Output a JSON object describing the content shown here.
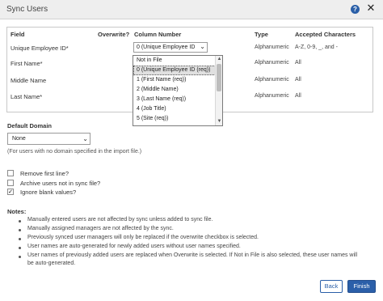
{
  "dialog": {
    "title": "Sync Users",
    "help_icon": "question-circle-icon",
    "close_icon": "close-x-icon"
  },
  "grid": {
    "headers": {
      "field": "Field",
      "overwrite": "Overwrite?",
      "column_number": "Column Number",
      "type": "Type",
      "accepted": "Accepted Characters"
    },
    "rows": [
      {
        "field": "Unique Employee ID*",
        "column_value": "0 (Unique Employee ID",
        "type": "Alphanumeric",
        "accepted": "A-Z, 0-9, _, and -"
      },
      {
        "field": "First Name*",
        "column_value": "",
        "type": "Alphanumeric",
        "accepted": "All"
      },
      {
        "field": "Middle Name",
        "column_value": "",
        "type": "Alphanumeric",
        "accepted": "All"
      },
      {
        "field": "Last Name*",
        "column_value": "",
        "type": "Alphanumeric",
        "accepted": "All"
      }
    ]
  },
  "dropdown": {
    "options": [
      "Not in File",
      "0 (Unique Employee ID (req))",
      "1 (First Name (req))",
      "2 (Middle Name)",
      "3 (Last Name (req))",
      "4 (Job Title)",
      "5 (Site (req))"
    ],
    "selected_index": 1
  },
  "default_domain": {
    "label": "Default Domain",
    "value": "None",
    "hint": "(For users with no domain specified in the import file.)"
  },
  "options": [
    {
      "label": "Remove first line?",
      "checked": false
    },
    {
      "label": "Archive users not in sync file?",
      "checked": false
    },
    {
      "label": "Ignore blank values?",
      "checked": true
    }
  ],
  "notes": {
    "label": "Notes:",
    "items": [
      "Manually entered users are not affected by sync unless added to sync file.",
      "Manually assigned managers are not affected by the sync.",
      "Previously synced user managers will only be replaced if the overwrite checkbox is selected.",
      "User names are auto-generated for newly added users without user names specified.",
      "User names of previously added users are replaced when Overwrite is selected. If Not in File is also selected, these user names will",
      "be auto-generated."
    ]
  },
  "buttons": {
    "back": "Back",
    "finish": "Finish"
  },
  "colors": {
    "accent": "#2b5fa9",
    "titlebar": "#eeeeee"
  }
}
